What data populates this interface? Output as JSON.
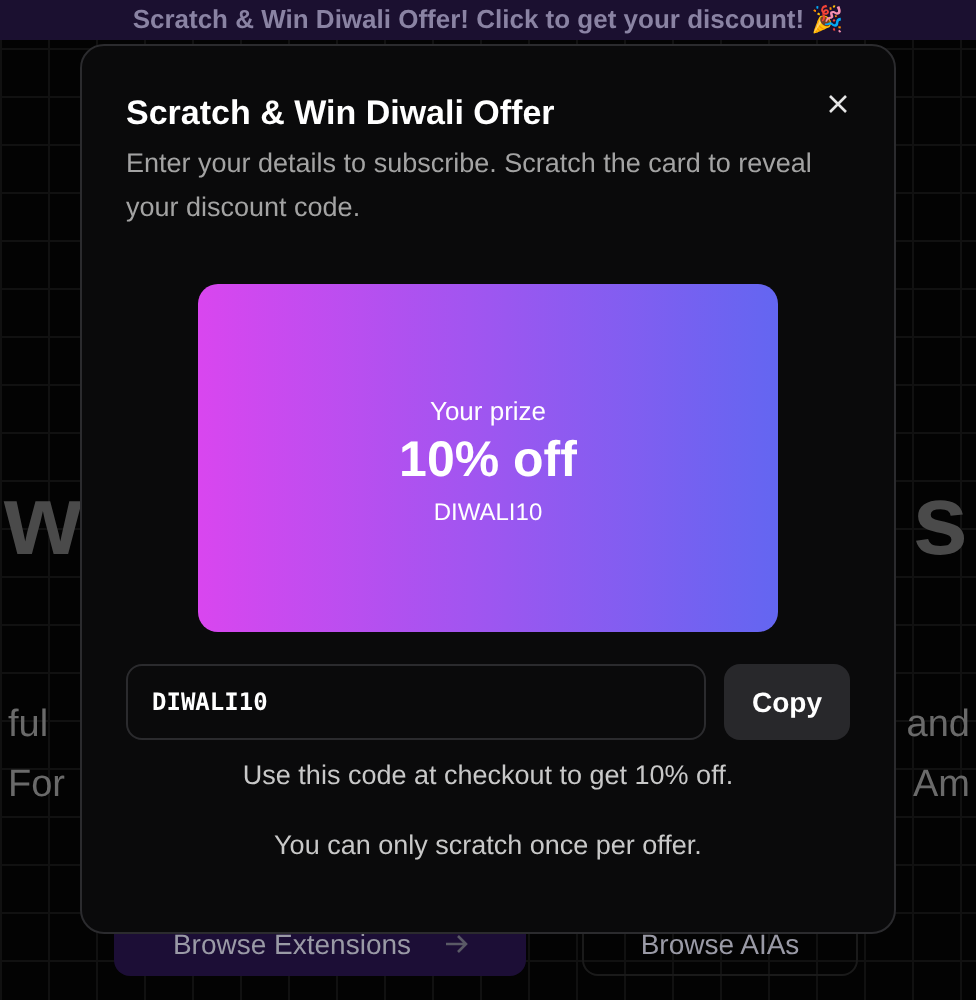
{
  "banner": {
    "text": "Scratch & Win Diwali Offer! Click to get your discount! 🎉"
  },
  "background": {
    "heading_left": "w",
    "heading_right": "s",
    "text_lines": [
      {
        "left": "ful",
        "right": "and"
      },
      {
        "left": "For",
        "right": "Am"
      }
    ],
    "buttons": [
      {
        "label": "Browse Extensions",
        "kind": "primary"
      },
      {
        "label": "Browse AIAs",
        "kind": "outline"
      }
    ]
  },
  "modal": {
    "title": "Scratch & Win Diwali Offer",
    "subtitle": "Enter your details to subscribe. Scratch the card to reveal your discount code.",
    "card": {
      "label": "Your prize",
      "prize": "10% off",
      "code": "DIWALI10"
    },
    "code_field": {
      "value": "DIWALI10"
    },
    "copy_button": "Copy",
    "notes": [
      "Use this code at checkout to get 10% off.",
      "You can only scratch once per offer."
    ]
  }
}
